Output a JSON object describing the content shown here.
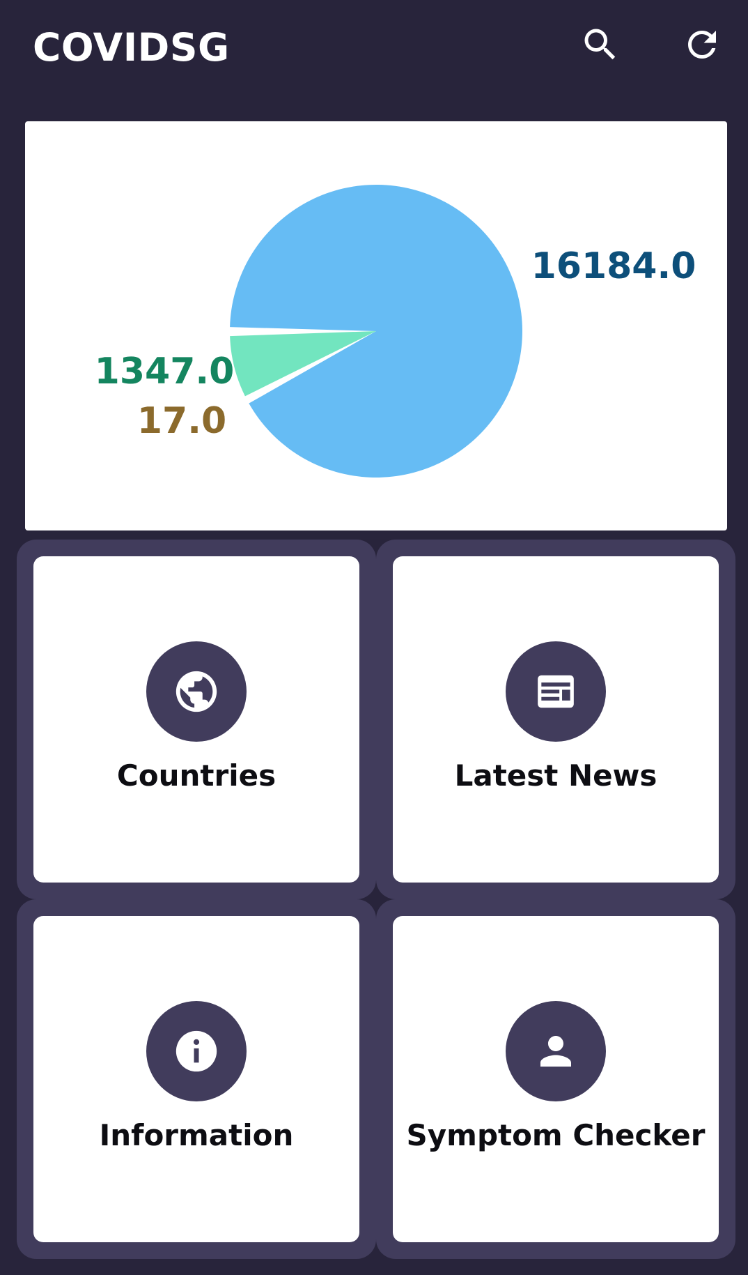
{
  "app": {
    "title": "COVIDSG"
  },
  "actions": {
    "search_icon": "search-icon",
    "refresh_icon": "refresh-icon"
  },
  "chart_data": {
    "type": "pie",
    "slices": [
      {
        "value": 16184.0,
        "label": "16184.0",
        "color": "#66bcf4",
        "label_color": "#0d4f7a"
      },
      {
        "value": 1347.0,
        "label": "1347.0",
        "color": "#72e5bf",
        "label_color": "#14855f"
      },
      {
        "value": 17.0,
        "label": "17.0",
        "color": "#a47b3c",
        "label_color": "#8b6a2c"
      }
    ]
  },
  "tiles": [
    {
      "label": "Countries",
      "icon": "globe-icon"
    },
    {
      "label": "Latest News",
      "icon": "newspaper-icon"
    },
    {
      "label": "Information",
      "icon": "info-icon"
    },
    {
      "label": "Symptom Checker",
      "icon": "person-icon"
    }
  ],
  "colors": {
    "background": "#28243b",
    "tile_frame": "#413c5c",
    "card": "#ffffff"
  }
}
